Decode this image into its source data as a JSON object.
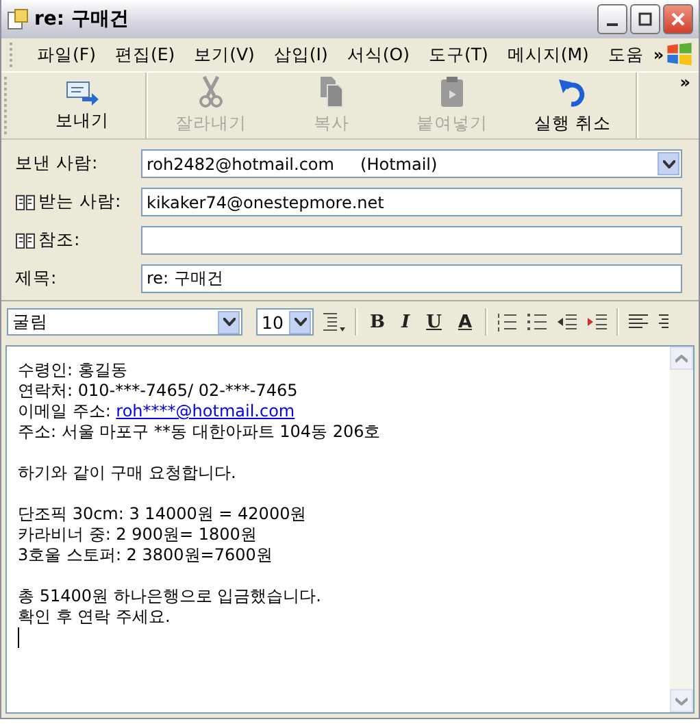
{
  "window": {
    "title": "re: 구매건"
  },
  "menu": [
    "파일(F)",
    "편집(E)",
    "보기(V)",
    "삽입(I)",
    "서식(O)",
    "도구(T)",
    "메시지(M)",
    "도움"
  ],
  "menu_overflow": "»",
  "toolbar": [
    {
      "kind": "send",
      "label": "보내기",
      "disabled": false
    },
    {
      "kind": "cut",
      "label": "잘라내기",
      "disabled": true
    },
    {
      "kind": "copy",
      "label": "복사",
      "disabled": true
    },
    {
      "kind": "paste",
      "label": "붙여넣기",
      "disabled": true
    },
    {
      "kind": "undo",
      "label": "실행 취소",
      "disabled": false
    }
  ],
  "toolbar_overflow": "»",
  "fields": [
    {
      "kind": "dropdown",
      "label": "보낸 사람:",
      "value": "roh2482@hotmail.com     (Hotmail)",
      "book": false
    },
    {
      "kind": "input",
      "label": "받는 사람:",
      "value": "kikaker74@onestepmore.net",
      "book": true
    },
    {
      "kind": "input",
      "label": "참조:",
      "book": true
    },
    {
      "kind": "input",
      "label": "제목:",
      "value": "re: 구매건",
      "book": false
    }
  ],
  "format": {
    "font": "굴림",
    "size": "10",
    "bold": "B",
    "italic": "I",
    "underline": "U",
    "color_label": "A"
  },
  "body": [
    [
      {
        "text": "수령인: 홍길동"
      },
      {
        "text": "연락처: 010-***-7465/ 02-***-7465"
      },
      {
        "text": "이메일 주소: ",
        "link": "roh****@hotmail.com"
      },
      {
        "text": "주소: 서울 마포구 **동 대한아파트 104동 206호"
      }
    ],
    [
      {
        "text": "하기와 같이 구매 요청합니다."
      }
    ],
    [
      {
        "text": "단조픽 30cm: 3  14000원 = 42000원"
      },
      {
        "text": "카라비너 중: 2 900원= 1800원"
      },
      {
        "text": "3호울 스토퍼: 2 3800원=7600원"
      }
    ],
    [
      {
        "text": "총 51400원 하나은행으로 입금했습니다."
      },
      {
        "text": "확인 후 연락 주세요."
      }
    ]
  ]
}
